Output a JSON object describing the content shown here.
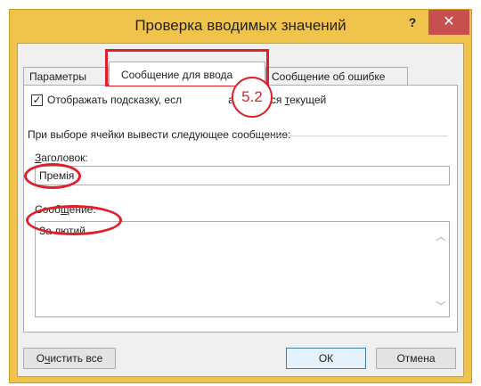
{
  "window": {
    "title": "Проверка вводимых значений",
    "help_label": "?",
    "close_label": "✕"
  },
  "tabs": [
    {
      "label": "Параметры",
      "active": false
    },
    {
      "label": "Сообщение для ввода",
      "active": true
    },
    {
      "label": "Сообщение об ошибке",
      "active": false
    }
  ],
  "panel": {
    "show_tip_checkbox": {
      "checked": true,
      "label_before": "Отображать подсказку, есл",
      "label_after": "а является ",
      "label_underlined": "т",
      "label_end": "екущей"
    },
    "group_label": "При выборе ячейки вывести следующее сообщение:",
    "title_field": {
      "label_underlined": "З",
      "label_rest": "аголовок:",
      "value": "Премія"
    },
    "message_field": {
      "label_prefix": "Сооб",
      "label_underlined": "щ",
      "label_rest": "ение:",
      "value": "За лютий"
    }
  },
  "annotation_badge": "5.2",
  "footer": {
    "clear_all_prefix": "О",
    "clear_all_underlined": "ч",
    "clear_all_rest": "истить все",
    "ok_label": "ОК",
    "cancel_label": "Отмена"
  },
  "colors": {
    "title_bar": "#f0c44c",
    "close_button": "#c7504e",
    "annotation": "#e01f2a"
  }
}
